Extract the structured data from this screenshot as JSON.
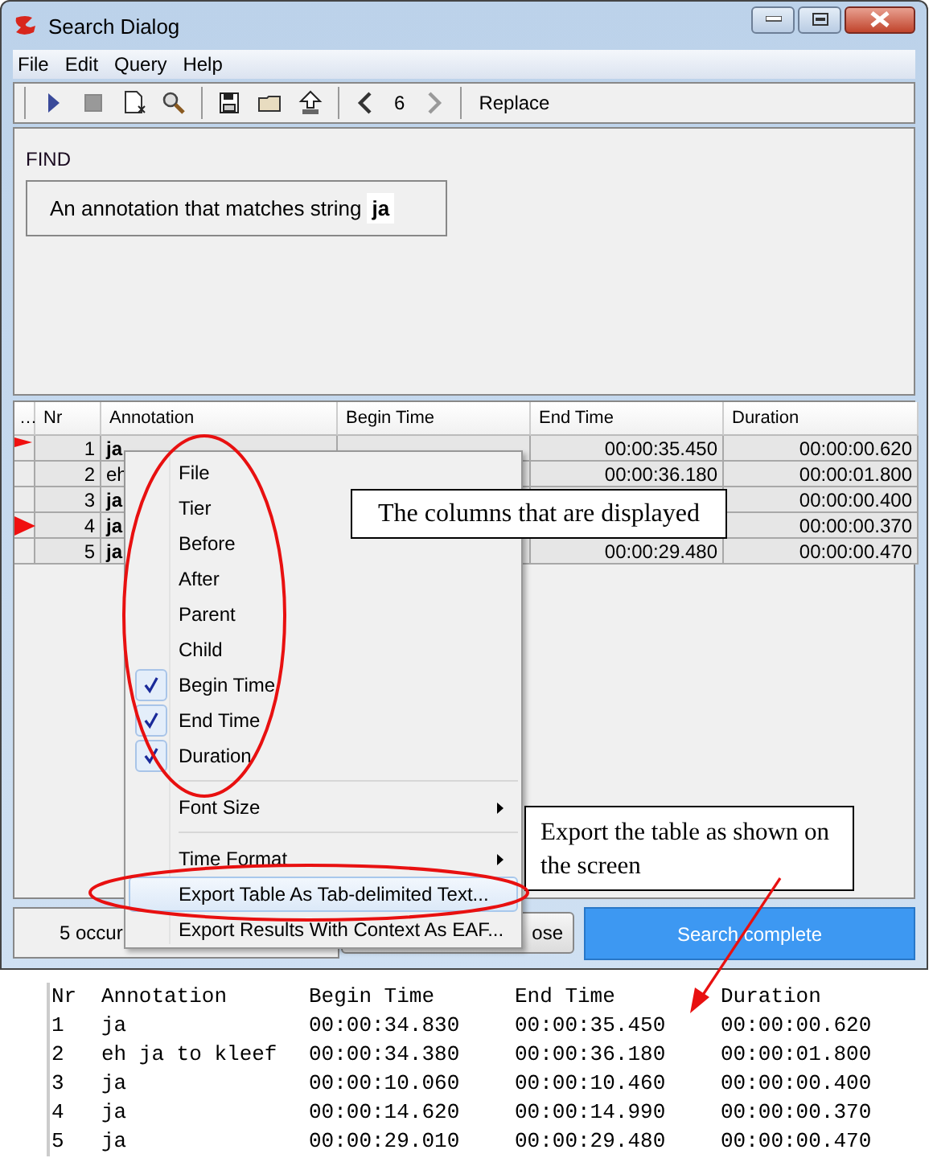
{
  "window": {
    "title": "Search Dialog"
  },
  "menu_bar": [
    "File",
    "Edit",
    "Query",
    "Help"
  ],
  "toolbar": {
    "page": "6",
    "replace_button": "Replace"
  },
  "find": {
    "label": "FIND",
    "query": "An annotation that matches string **ja**"
  },
  "table": {
    "columns": [
      "…",
      "Nr",
      "Annotation",
      "Begin Time",
      "End Time",
      "Duration"
    ],
    "rows": [
      {
        "marked": true,
        "nr": "1",
        "annotation": "ja",
        "bold": true,
        "end_time": "00:00:35.450",
        "duration": "00:00:00.620"
      },
      {
        "marked": false,
        "nr": "2",
        "annotation": "eh",
        "bold": false,
        "end_time": "00:00:36.180",
        "duration": "00:00:01.800"
      },
      {
        "marked": false,
        "nr": "3",
        "annotation": "ja",
        "bold": true,
        "duration": "00:00:00.400"
      },
      {
        "marked": true,
        "nr": "4",
        "annotation": "ja",
        "bold": true,
        "duration": "00:00:00.370"
      },
      {
        "marked": false,
        "nr": "5",
        "annotation": "ja",
        "bold": true,
        "end_time": "00:00:29.480",
        "duration": "00:00:00.470"
      }
    ]
  },
  "status": {
    "text": "5 occur",
    "close_button": "ose",
    "progress": "Search complete",
    "level": 1
  },
  "context_menu": {
    "items": [
      {
        "kind": "check",
        "label": "File",
        "checked": false,
        "highlighted": false
      },
      {
        "kind": "check",
        "label": "Tier",
        "checked": false,
        "highlighted": false
      },
      {
        "kind": "check",
        "label": "Before",
        "checked": false,
        "highlighted": false
      },
      {
        "kind": "check",
        "label": "After",
        "checked": false,
        "highlighted": false
      },
      {
        "kind": "check",
        "label": "Parent",
        "checked": false,
        "highlighted": false
      },
      {
        "kind": "check",
        "label": "Child",
        "checked": false,
        "highlighted": false
      },
      {
        "kind": "check",
        "label": "Begin Time",
        "checked": true,
        "highlighted": false
      },
      {
        "kind": "check",
        "label": "End Time",
        "checked": true,
        "highlighted": false
      },
      {
        "kind": "check",
        "label": "Duration",
        "checked": true,
        "highlighted": false
      },
      {
        "kind": "separator"
      },
      {
        "kind": "submenu",
        "label": "Font Size",
        "highlighted": false
      },
      {
        "kind": "separator"
      },
      {
        "kind": "submenu",
        "label": "Time Format",
        "highlighted": false
      },
      {
        "kind": "action",
        "label": "Export Table As Tab-delimited Text...",
        "highlighted": true
      },
      {
        "kind": "action",
        "label": "Export Results With Context As EAF...",
        "highlighted": false
      }
    ]
  },
  "callouts": [
    {
      "text": "The columns that are displayed"
    },
    {
      "text": "Export the table as shown on the screen"
    }
  ],
  "export_preview": {
    "header": [
      "Nr",
      "Annotation",
      "Begin Time",
      "End Time",
      "Duration"
    ],
    "rows": [
      [
        "1",
        "ja",
        "00:00:34.830",
        "00:00:35.450",
        "00:00:00.620"
      ],
      [
        "2",
        "eh ja to kleef",
        "00:00:34.380",
        "00:00:36.180",
        "00:00:01.800"
      ],
      [
        "3",
        "ja",
        "00:00:10.060",
        "00:00:10.460",
        "00:00:00.400"
      ],
      [
        "4",
        "ja",
        "00:00:14.620",
        "00:00:14.990",
        "00:00:00.370"
      ],
      [
        "5",
        "ja",
        "00:00:29.010",
        "00:00:29.480",
        "00:00:00.470"
      ]
    ]
  }
}
